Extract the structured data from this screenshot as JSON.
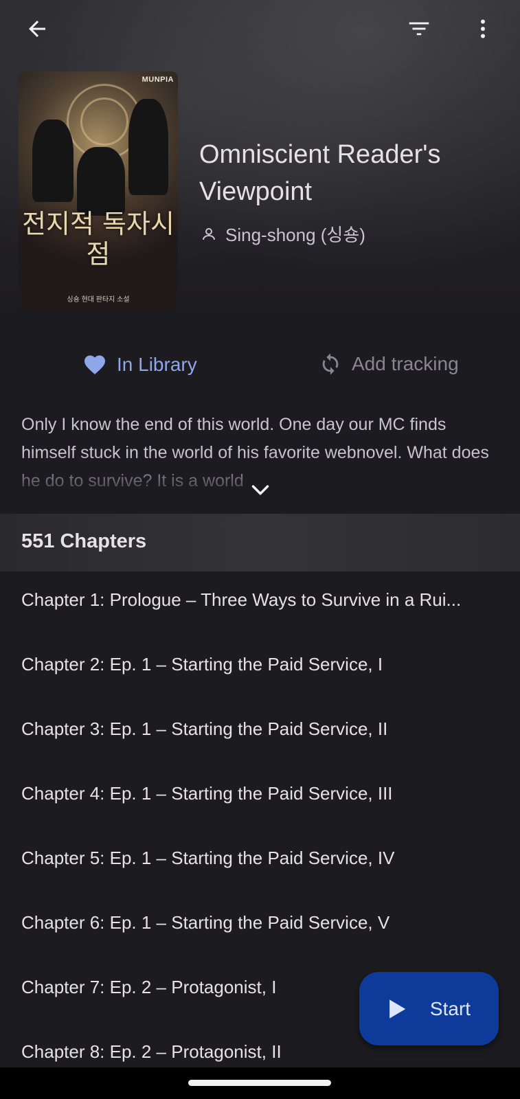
{
  "manga": {
    "title": "Omniscient Reader's Viewpoint",
    "author": "Sing-shong (싱숑)",
    "cover": {
      "publisher": "MUNPIA",
      "korean_title": "전지적 독자시점",
      "korean_subtitle": "싱숑 현대 판타지 소설"
    }
  },
  "actions": {
    "library_label": "In Library",
    "tracking_label": "Add tracking"
  },
  "description": "Only I know the end of this world. One day our MC finds himself stuck in the world of his favorite webnovel. What does he do to survive? It is a world",
  "chapters": {
    "count_label": "551 Chapters",
    "items": [
      {
        "title": "Chapter 1: Prologue – Three Ways to Survive in a Rui..."
      },
      {
        "title": "Chapter 2: Ep. 1 – Starting the Paid Service, I"
      },
      {
        "title": "Chapter 3: Ep. 1 – Starting the Paid Service, II"
      },
      {
        "title": "Chapter 4: Ep. 1 – Starting the Paid Service, III"
      },
      {
        "title": "Chapter 5: Ep. 1 – Starting the Paid Service, IV"
      },
      {
        "title": "Chapter 6: Ep. 1 – Starting the Paid Service, V"
      },
      {
        "title": "Chapter 7: Ep. 2 – Protagonist, I"
      },
      {
        "title": "Chapter 8: Ep. 2 – Protagonist, II"
      }
    ]
  },
  "fab": {
    "label": "Start"
  },
  "icons": {
    "back": "arrow-left-icon",
    "filter": "filter-icon",
    "more": "more-vert-icon",
    "heart": "heart-icon",
    "sync": "sync-icon",
    "person": "person-icon",
    "expand": "chevron-down-icon",
    "play": "play-icon"
  },
  "colors": {
    "background": "#1c1b1f",
    "accent": "#8fa6e8",
    "fab": "#0e3b9a",
    "muted": "#8a868e"
  }
}
